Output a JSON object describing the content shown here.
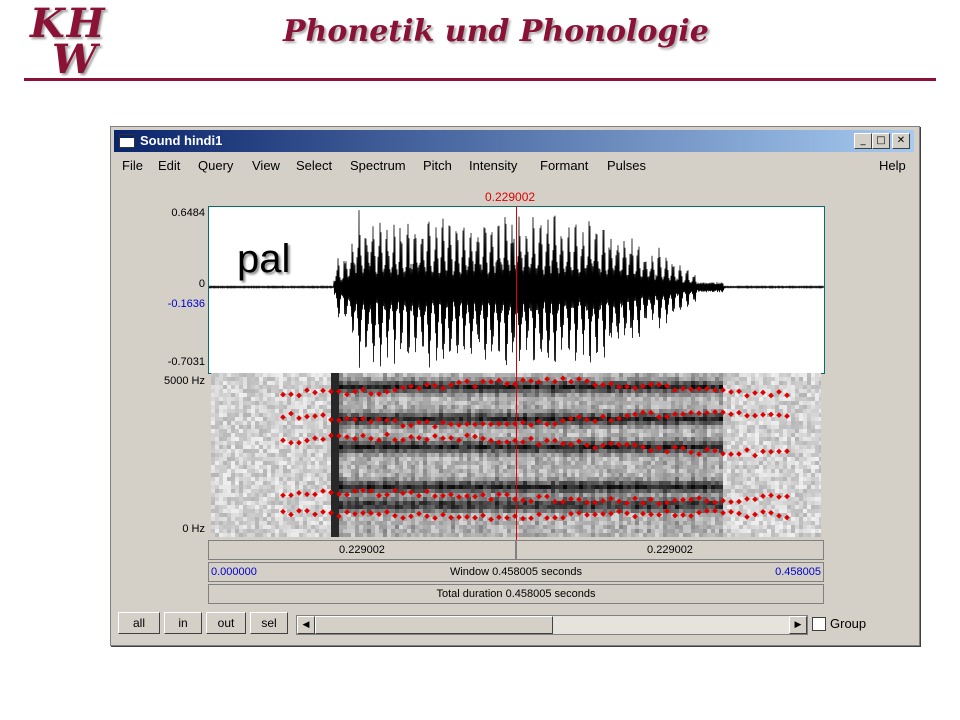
{
  "slide": {
    "logo_line1": "KH",
    "logo_line2": "W",
    "title": "Phonetik und Phonologie"
  },
  "window": {
    "title": "Sound hindi1",
    "minimize": "_",
    "maximize": "□",
    "close": "✕"
  },
  "menu": [
    "File",
    "Edit",
    "Query",
    "View",
    "Select",
    "Spectrum",
    "Pitch",
    "Intensity",
    "Formant",
    "Pulses",
    "Help"
  ],
  "cursor_time": "0.229002",
  "wave": {
    "max": "0.6484",
    "zero": "0",
    "cursor_value": "-0.1636",
    "min": "-0.7031",
    "overlay_word": "pal"
  },
  "spectrogram": {
    "top_freq": "5000 Hz",
    "bottom_freq": "0 Hz"
  },
  "bars": {
    "left_segment": "0.229002",
    "right_segment": "0.229002",
    "window_start": "0.000000",
    "window_label": "Window 0.458005 seconds",
    "window_end": "0.458005",
    "total_duration": "Total duration 0.458005 seconds"
  },
  "buttons": {
    "all": "all",
    "in": "in",
    "out": "out",
    "sel": "sel",
    "group": "Group"
  },
  "colors": {
    "brand": "#8a1236",
    "cursor": "#e00000",
    "formant": "#e00000",
    "blue_text": "#0000cc"
  }
}
